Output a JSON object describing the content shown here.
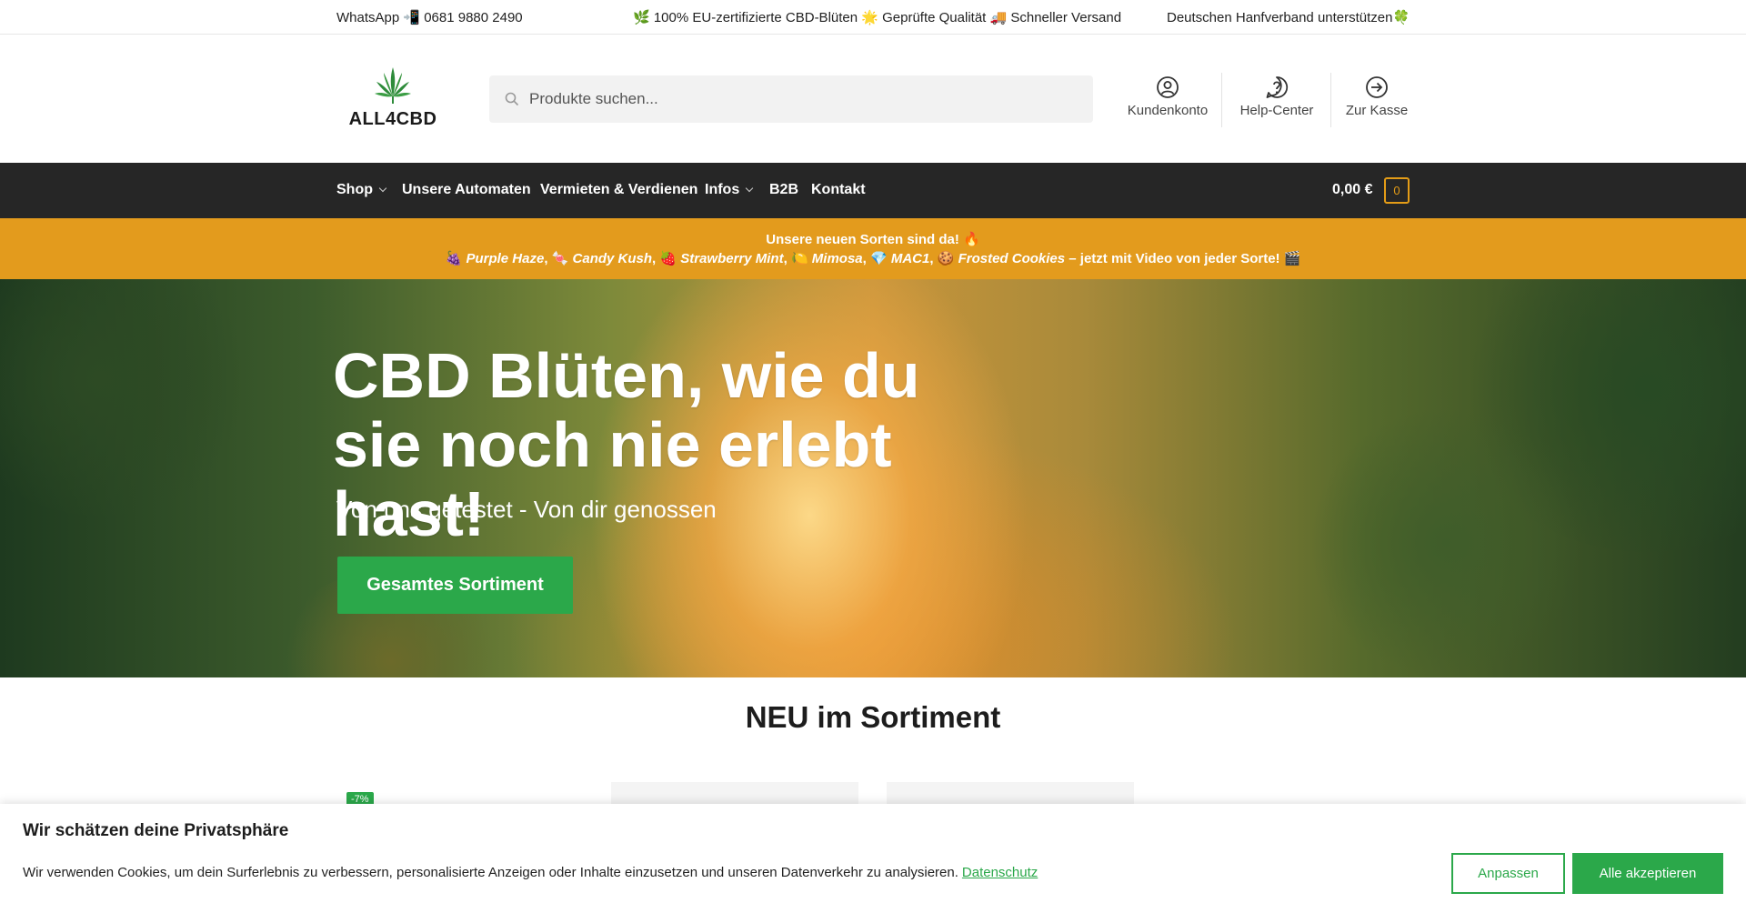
{
  "topbar": {
    "whatsapp": "WhatsApp 📲  0681 9880 2490",
    "usps": "🌿 100% EU-zertifizierte CBD-Blüten 🌟 Geprüfte Qualität 🚚 Schneller Versand",
    "support": "Deutschen Hanfverband unterstützen🍀"
  },
  "header": {
    "logo_text": "ALL4CBD",
    "search_placeholder": "Produkte suchen...",
    "links": {
      "account": "Kundenkonto",
      "help": "Help-Center",
      "checkout": "Zur Kasse"
    }
  },
  "nav": {
    "items": [
      "Shop",
      "Unsere Automaten",
      "Vermieten & Verdienen",
      "Infos",
      "B2B",
      "Kontakt"
    ],
    "cart_total": "0,00 €",
    "cart_count": "0"
  },
  "promo": {
    "line1": "Unsere neuen Sorten sind da! 🔥",
    "line2_prefix": "🍇 ",
    "strains": [
      "Purple Haze",
      "Candy Kush",
      "Strawberry Mint",
      "Mimosa",
      "MAC1",
      "Frosted Cookies"
    ],
    "strain_icons": [
      "🍬",
      "🍓",
      "🍋",
      "💎",
      "🍪"
    ],
    "line2_suffix": " – jetzt mit Video von jeder Sorte! 🎬"
  },
  "hero": {
    "title": "CBD Blüten, wie du sie noch nie erlebt hast!",
    "subtitle": "Von uns getestet - Von dir genossen",
    "button": "Gesamtes Sortiment"
  },
  "section": {
    "title": "NEU im Sortiment",
    "badge": "-7%"
  },
  "cookie": {
    "title": "Wir schätzen deine Privatsphäre",
    "text": "Wir verwenden Cookies, um dein Surferlebnis zu verbessern, personalisierte Anzeigen oder Inhalte einzusetzen und unseren Datenverkehr zu analysieren.",
    "link": "Datenschutz",
    "customize": "Anpassen",
    "accept": "Alle akzeptieren"
  },
  "colors": {
    "accent_green": "#2ba84a",
    "promo_orange": "#e39b1d",
    "nav_dark": "#262626"
  }
}
